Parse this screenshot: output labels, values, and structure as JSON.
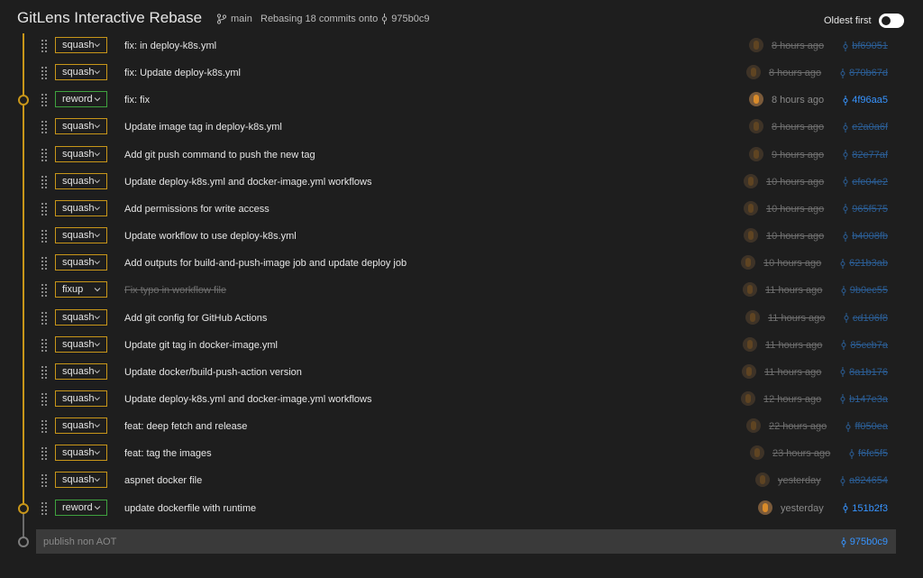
{
  "header": {
    "title": "GitLens Interactive Rebase",
    "branch": "main",
    "rebasing_text": "Rebasing 18 commits onto",
    "onto_sha": "975b0c9",
    "oldest_first_label": "Oldest first"
  },
  "commits": [
    {
      "action": "squash",
      "message": "fix: in deploy-k8s.yml",
      "time": "8 hours ago",
      "sha": "bf69051",
      "dim": true
    },
    {
      "action": "squash",
      "message": "fix: Update deploy-k8s.yml",
      "time": "8 hours ago",
      "sha": "870b67d",
      "dim": true
    },
    {
      "action": "reword",
      "message": "fix: fix",
      "time": "8 hours ago",
      "sha": "4f96aa5",
      "dim": false
    },
    {
      "action": "squash",
      "message": "Update image tag in deploy-k8s.yml",
      "time": "8 hours ago",
      "sha": "e2a0a6f",
      "dim": true
    },
    {
      "action": "squash",
      "message": "Add git push command to push the new tag",
      "time": "9 hours ago",
      "sha": "82e77af",
      "dim": true
    },
    {
      "action": "squash",
      "message": "Update deploy-k8s.yml and docker-image.yml workflows",
      "time": "10 hours ago",
      "sha": "efe04e2",
      "dim": true
    },
    {
      "action": "squash",
      "message": "Add permissions for write access",
      "time": "10 hours ago",
      "sha": "965f575",
      "dim": true
    },
    {
      "action": "squash",
      "message": "Update workflow to use deploy-k8s.yml",
      "time": "10 hours ago",
      "sha": "b4008fb",
      "dim": true
    },
    {
      "action": "squash",
      "message": "Add outputs for build-and-push-image job and update deploy job",
      "time": "10 hours ago",
      "sha": "621b3ab",
      "dim": true
    },
    {
      "action": "fixup",
      "message": "Fix typo in workflow file",
      "time": "11 hours ago",
      "sha": "9b0ec55",
      "dim": true
    },
    {
      "action": "squash",
      "message": "Add git config for GitHub Actions",
      "time": "11 hours ago",
      "sha": "cd106f8",
      "dim": true
    },
    {
      "action": "squash",
      "message": "Update git tag in docker-image.yml",
      "time": "11 hours ago",
      "sha": "85ccb7a",
      "dim": true
    },
    {
      "action": "squash",
      "message": "Update docker/build-push-action version",
      "time": "11 hours ago",
      "sha": "8a1b176",
      "dim": true
    },
    {
      "action": "squash",
      "message": "Update deploy-k8s.yml and docker-image.yml workflows",
      "time": "12 hours ago",
      "sha": "b147e3a",
      "dim": true
    },
    {
      "action": "squash",
      "message": "feat: deep fetch and release",
      "time": "22 hours ago",
      "sha": "ff050ea",
      "dim": true
    },
    {
      "action": "squash",
      "message": "feat: tag the images",
      "time": "23 hours ago",
      "sha": "f6fc5f5",
      "dim": true
    },
    {
      "action": "squash",
      "message": "aspnet docker file",
      "time": "yesterday",
      "sha": "a824654",
      "dim": true
    },
    {
      "action": "reword",
      "message": "update dockerfile with runtime",
      "time": "yesterday",
      "sha": "151b2f3",
      "dim": false
    }
  ],
  "base": {
    "message": "publish non AOT",
    "sha": "975b0c9"
  },
  "colors": {
    "squash_border": "#c89619",
    "reword_border": "#3fa23f",
    "sha_link": "#3794ff",
    "graph_line": "#c89619"
  }
}
